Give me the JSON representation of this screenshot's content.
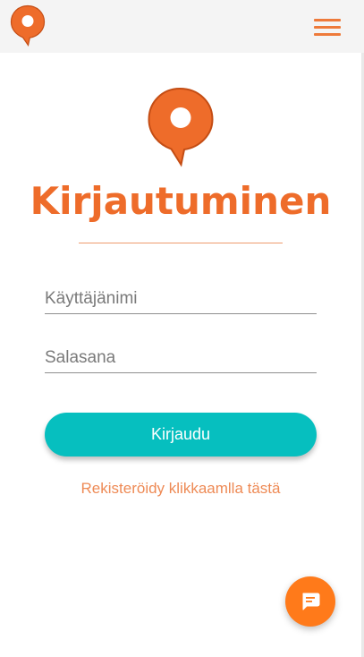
{
  "header": {
    "logo_icon": "location-pin-icon",
    "menu_icon": "hamburger-menu-icon"
  },
  "login": {
    "logo_icon": "location-pin-icon",
    "title": "Kirjautuminen",
    "username_placeholder": "Käyttäjänimi",
    "password_placeholder": "Salasana",
    "submit_label": "Kirjaudu",
    "register_link": "Rekisteröidy klikkaamlla tästä"
  },
  "chat": {
    "icon": "chat-bubble-icon"
  },
  "colors": {
    "brand_orange": "#ee6c2a",
    "button_teal": "#06bfbf",
    "link_orange": "#ee8a55",
    "chat_orange": "#ff7a1a",
    "header_bg": "#f4f4f4"
  }
}
